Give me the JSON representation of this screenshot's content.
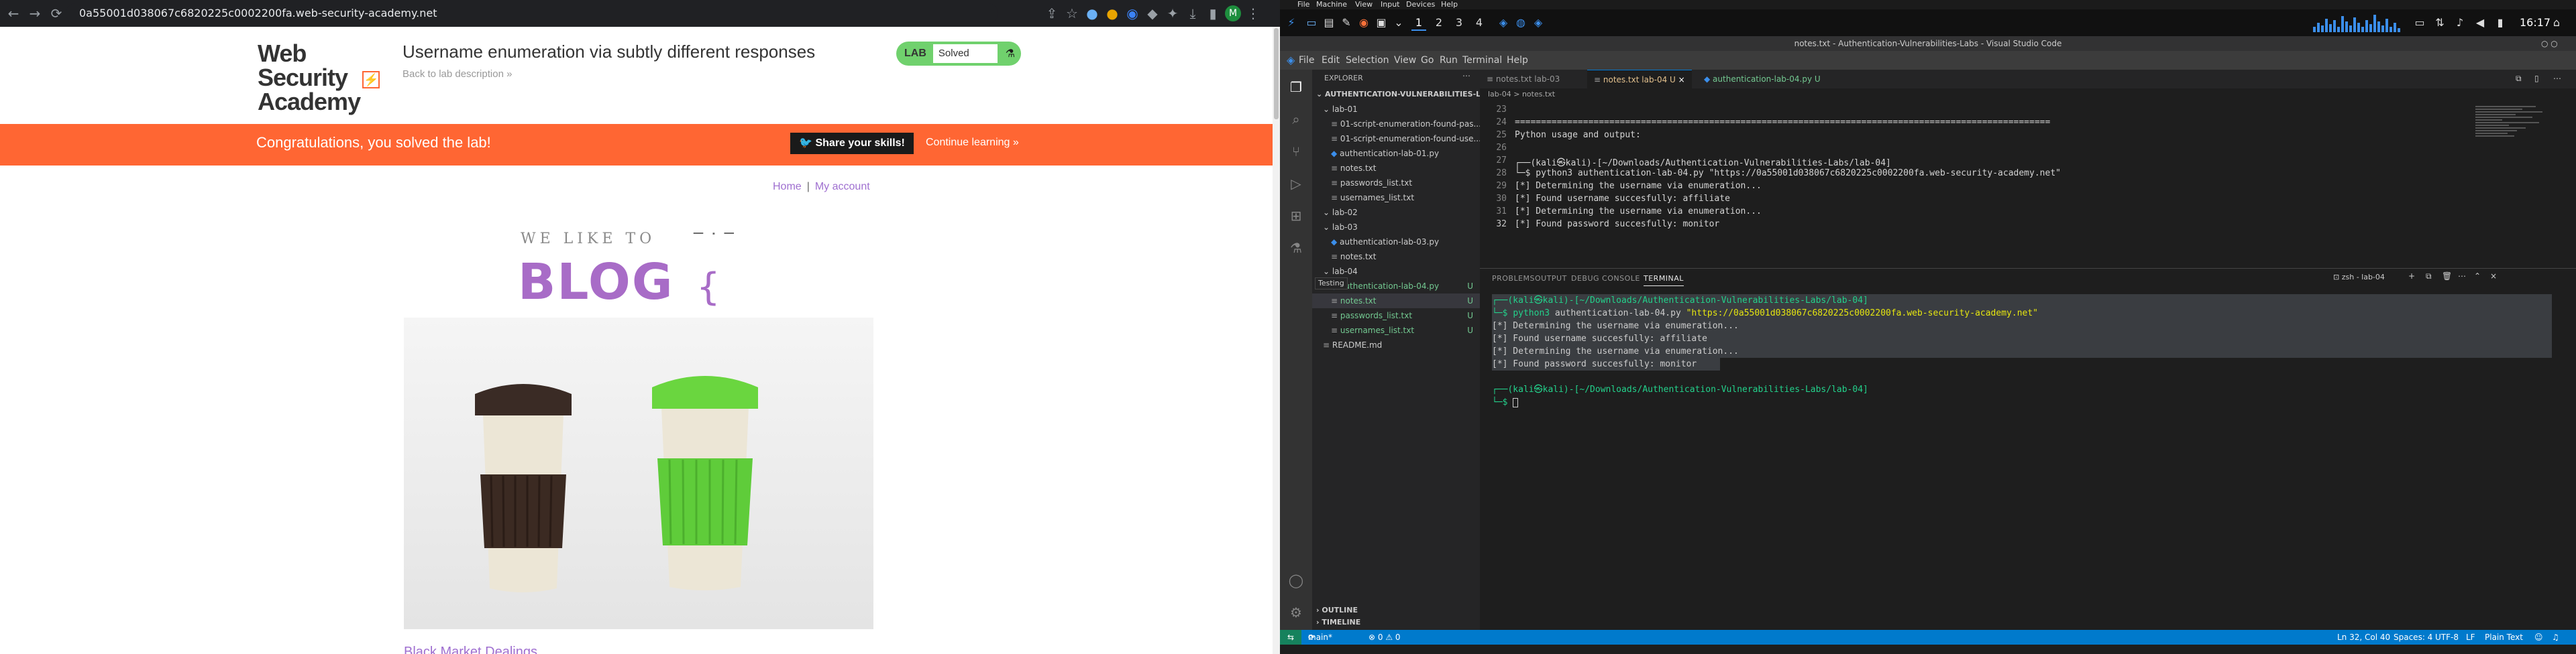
{
  "browser": {
    "url": "0a55001d038067c6820225c0002200fa.web-security-academy.net",
    "logo_line1": "Web Security",
    "logo_line2": "Academy",
    "lab_title": "Username enumeration via subtly different responses",
    "back_link": "Back to lab description",
    "lab_badge": "LAB",
    "lab_status": "Solved",
    "congrats": "Congratulations, you solved the lab!",
    "share": "Share your skills!",
    "continue": "Continue learning",
    "nav_home": "Home",
    "nav_sep": "|",
    "nav_account": "My account",
    "blog_tag": "WE LIKE TO",
    "blog_word": "BLOG",
    "post_title": "Black Market Dealings"
  },
  "desktop": {
    "menu": [
      "File",
      "Machine",
      "View",
      "Input",
      "Devices",
      "Help"
    ],
    "workspaces": [
      "1",
      "2",
      "3",
      "4"
    ],
    "clock": "16:17"
  },
  "vscode": {
    "title": "notes.txt - Authentication-Vulnerabilities-Labs - Visual Studio Code",
    "menu": [
      "File",
      "Edit",
      "Selection",
      "View",
      "Go",
      "Run",
      "Terminal",
      "Help"
    ],
    "explorer_label": "EXPLORER",
    "root": "AUTHENTICATION-VULNERABILITIES-LABS",
    "tree": [
      {
        "name": "lab-01",
        "indent": 1,
        "type": "folder"
      },
      {
        "name": "01-script-enumeration-found-pas...",
        "indent": 2,
        "type": "file"
      },
      {
        "name": "01-script-enumeration-found-use...",
        "indent": 2,
        "type": "file"
      },
      {
        "name": "authentication-lab-01.py",
        "indent": 2,
        "type": "py"
      },
      {
        "name": "notes.txt",
        "indent": 2,
        "type": "file"
      },
      {
        "name": "passwords_list.txt",
        "indent": 2,
        "type": "file"
      },
      {
        "name": "usernames_list.txt",
        "indent": 2,
        "type": "file"
      },
      {
        "name": "lab-02",
        "indent": 1,
        "type": "folder"
      },
      {
        "name": "lab-03",
        "indent": 1,
        "type": "folder"
      },
      {
        "name": "authentication-lab-03.py",
        "indent": 2,
        "type": "py"
      },
      {
        "name": "notes.txt",
        "indent": 2,
        "type": "file"
      },
      {
        "name": "lab-04",
        "indent": 1,
        "type": "folder"
      },
      {
        "name": "authentication-lab-04.py",
        "indent": 2,
        "type": "py",
        "badge": "U"
      },
      {
        "name": "notes.txt",
        "indent": 2,
        "type": "file",
        "badge": "U",
        "selected": true
      },
      {
        "name": "passwords_list.txt",
        "indent": 2,
        "type": "file",
        "badge": "U"
      },
      {
        "name": "usernames_list.txt",
        "indent": 2,
        "type": "file",
        "badge": "U"
      },
      {
        "name": "README.md",
        "indent": 1,
        "type": "file"
      }
    ],
    "tooltip": "Testing",
    "tabs": [
      {
        "label": "notes.txt lab-03",
        "active": false
      },
      {
        "label": "notes.txt lab-04 U",
        "active": true
      },
      {
        "label": "authentication-lab-04.py U",
        "active": false
      }
    ],
    "breadcrumb": "lab-04 > notes.txt",
    "editor_lines": [
      {
        "num": "23",
        "text": ""
      },
      {
        "num": "24",
        "text": "======================================================================================================"
      },
      {
        "num": "25",
        "text": "Python usage and output:"
      },
      {
        "num": "26",
        "text": ""
      },
      {
        "num": "27",
        "text": "┌──(kali㉿kali)-[~/Downloads/Authentication-Vulnerabilities-Labs/lab-04]"
      },
      {
        "num": "28",
        "text": "└─$ python3 authentication-lab-04.py \"https://0a55001d038067c6820225c0002200fa.web-security-academy.net\""
      },
      {
        "num": "29",
        "text": "[*] Determining the username via enumeration..."
      },
      {
        "num": "30",
        "text": "[*] Found username succesfully: affiliate"
      },
      {
        "num": "31",
        "text": "[*] Determining the username via enumeration..."
      },
      {
        "num": "32",
        "text": "[*] Found password succesfully: monitor"
      }
    ],
    "panel_tabs": [
      "PROBLEMS",
      "OUTPUT",
      "DEBUG CONSOLE",
      "TERMINAL"
    ],
    "terminal_name": "zsh - lab-04",
    "terminal": {
      "prompt1": "┌──(kali㉿kali)-[~/Downloads/Authentication-Vulnerabilities-Labs/lab-04]",
      "cmd_prefix": "└─$ ",
      "cmd": "python3",
      "cmd_args": " authentication-lab-04.py ",
      "cmd_url": "\"https://0a55001d038067c6820225c0002200fa.web-security-academy.net\"",
      "out1": "[*] Determining the username via enumeration...",
      "out2": "[*] Found username succesfully: affiliate",
      "out3": "[*] Determining the username via enumeration...",
      "out4": "[*] Found password succesfully: monitor",
      "prompt2": "┌──(kali㉿kali)-[~/Downloads/Authentication-Vulnerabilities-Labs/lab-04]",
      "prompt2_end": "└─$ "
    },
    "outline": "OUTLINE",
    "timeline": "TIMELINE",
    "status": {
      "branch": "main*",
      "problems": "⊗ 0 ⚠ 0",
      "position": "Ln 32, Col 40",
      "spaces": "Spaces: 4",
      "encoding": "UTF-8",
      "eol": "LF",
      "lang": "Plain Text"
    }
  }
}
